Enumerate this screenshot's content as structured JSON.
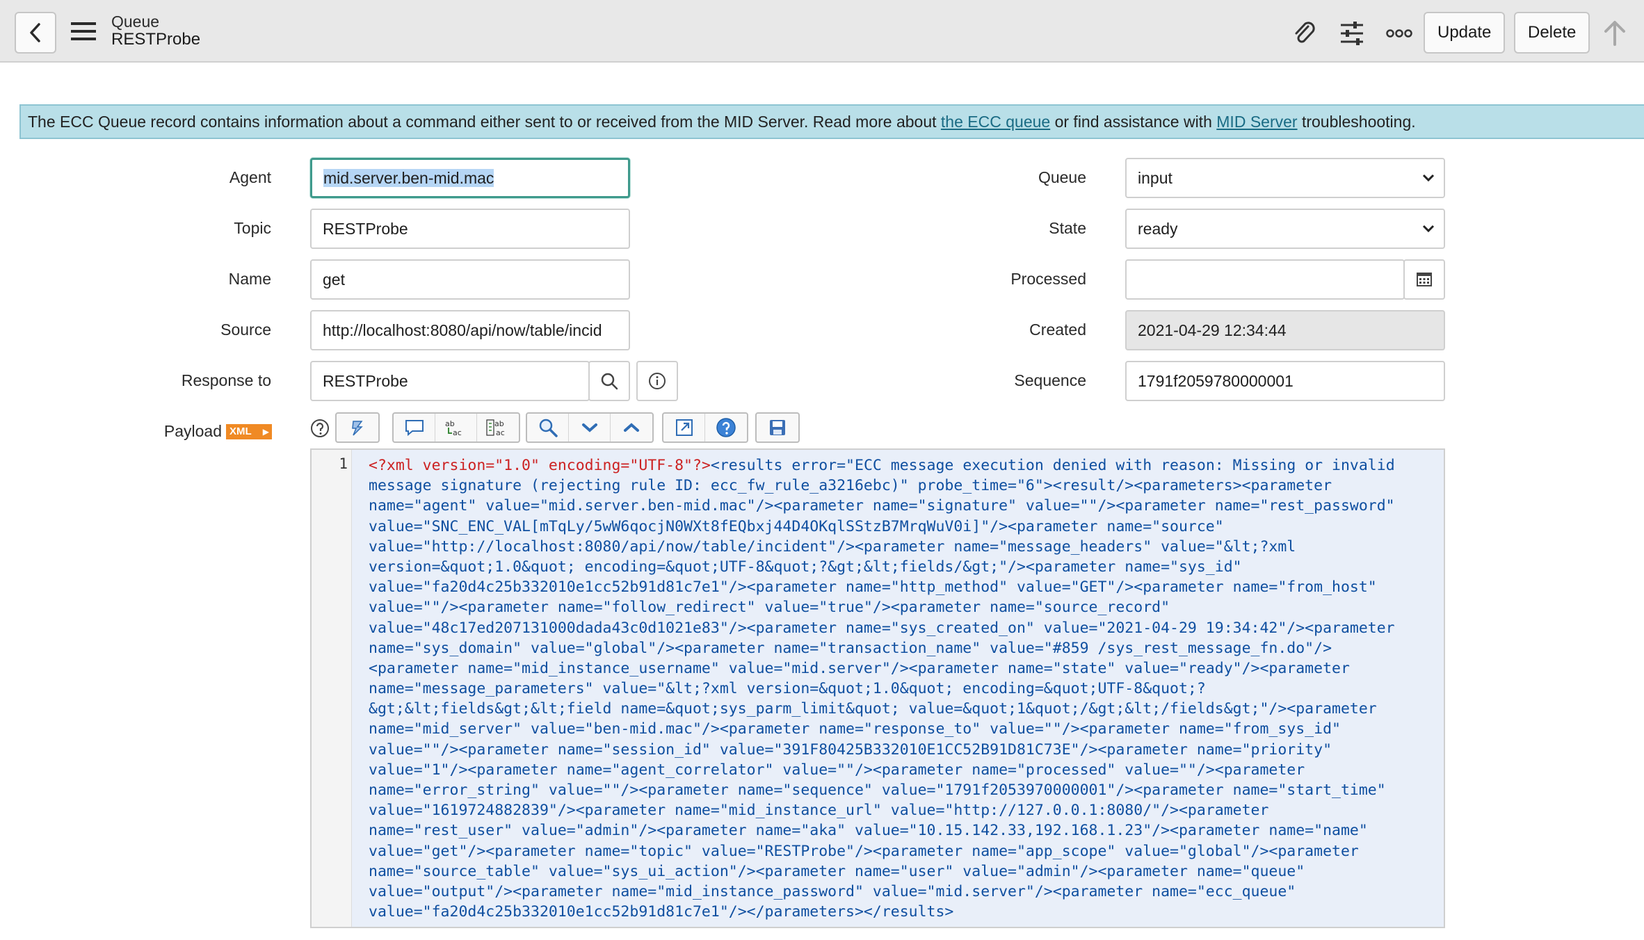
{
  "header": {
    "title": "Queue",
    "subtitle": "RESTProbe",
    "update_label": "Update",
    "delete_label": "Delete"
  },
  "banner": {
    "text_before": "The ECC Queue record contains information about a command either sent to or received from the MID Server. Read more about ",
    "link1": "the ECC queue",
    "text_middle": " or find assistance with ",
    "link2": "MID Server",
    "text_after": " troubleshooting."
  },
  "form": {
    "agent": {
      "label": "Agent",
      "value": "mid.server.ben-mid.mac"
    },
    "topic": {
      "label": "Topic",
      "value": "RESTProbe"
    },
    "name": {
      "label": "Name",
      "value": "get"
    },
    "source": {
      "label": "Source",
      "value": "http://localhost:8080/api/now/table/incid"
    },
    "response_to": {
      "label": "Response to",
      "value": "RESTProbe"
    },
    "payload": {
      "label": "Payload",
      "badge": "XML"
    },
    "queue": {
      "label": "Queue",
      "value": "input"
    },
    "state": {
      "label": "State",
      "value": "ready"
    },
    "processed": {
      "label": "Processed",
      "value": ""
    },
    "created": {
      "label": "Created",
      "value": "2021-04-29 12:34:44"
    },
    "sequence": {
      "label": "Sequence",
      "value": "1791f2059780000001"
    }
  },
  "editor": {
    "line_number": "1",
    "lines": [
      {
        "red": "<?xml version=\"1.0\" encoding=\"UTF-8\"?>",
        "text": "<results error=\"ECC message execution denied with reason: Missing or invalid"
      },
      {
        "text": "message signature (rejecting rule ID: ecc_fw_rule_a3216ebc)\" probe_time=\"6\"><result/><parameters><parameter"
      },
      {
        "text": "name=\"agent\" value=\"mid.server.ben-mid.mac\"/><parameter name=\"signature\" value=\"\"/><parameter name=\"rest_password\""
      },
      {
        "text": "value=\"SNC_ENC_VAL[mTqLy/5wW6qocjN0WXt8fEQbxj44D4OKqlSStzB7MrqWuV0i]\"/><parameter name=\"source\""
      },
      {
        "text": "value=\"http://localhost:8080/api/now/table/incident\"/><parameter name=\"message_headers\" value=\"&lt;?xml"
      },
      {
        "text": "version=&quot;1.0&quot; encoding=&quot;UTF-8&quot;?&gt;&lt;fields/&gt;\"/><parameter name=\"sys_id\""
      },
      {
        "text": "value=\"fa20d4c25b332010e1cc52b91d81c7e1\"/><parameter name=\"http_method\" value=\"GET\"/><parameter name=\"from_host\""
      },
      {
        "text": "value=\"\"/><parameter name=\"follow_redirect\" value=\"true\"/><parameter name=\"source_record\""
      },
      {
        "text": "value=\"48c17ed207131000dada43c0d1021e83\"/><parameter name=\"sys_created_on\" value=\"2021-04-29 19:34:42\"/><parameter"
      },
      {
        "text": "name=\"sys_domain\" value=\"global\"/><parameter name=\"transaction_name\" value=\"#859 /sys_rest_message_fn.do\"/>"
      },
      {
        "text": "<parameter name=\"mid_instance_username\" value=\"mid.server\"/><parameter name=\"state\" value=\"ready\"/><parameter"
      },
      {
        "text": "name=\"message_parameters\" value=\"&lt;?xml version=&quot;1.0&quot; encoding=&quot;UTF-8&quot;?"
      },
      {
        "text": "&gt;&lt;fields&gt;&lt;field name=&quot;sys_parm_limit&quot; value=&quot;1&quot;/&gt;&lt;/fields&gt;\"/><parameter"
      },
      {
        "text": "name=\"mid_server\" value=\"ben-mid.mac\"/><parameter name=\"response_to\" value=\"\"/><parameter name=\"from_sys_id\""
      },
      {
        "text": "value=\"\"/><parameter name=\"session_id\" value=\"391F80425B332010E1CC52B91D81C73E\"/><parameter name=\"priority\""
      },
      {
        "text": "value=\"1\"/><parameter name=\"agent_correlator\" value=\"\"/><parameter name=\"processed\" value=\"\"/><parameter"
      },
      {
        "text": "name=\"error_string\" value=\"\"/><parameter name=\"sequence\" value=\"1791f2053970000001\"/><parameter name=\"start_time\""
      },
      {
        "text": "value=\"1619724882839\"/><parameter name=\"mid_instance_url\" value=\"http://127.0.0.1:8080/\"/><parameter"
      },
      {
        "text": "name=\"rest_user\" value=\"admin\"/><parameter name=\"aka\" value=\"10.15.142.33,192.168.1.23\"/><parameter name=\"name\""
      },
      {
        "text": "value=\"get\"/><parameter name=\"topic\" value=\"RESTProbe\"/><parameter name=\"app_scope\" value=\"global\"/><parameter"
      },
      {
        "text": "name=\"source_table\" value=\"sys_ui_action\"/><parameter name=\"user\" value=\"admin\"/><parameter name=\"queue\""
      },
      {
        "text": "value=\"output\"/><parameter name=\"mid_instance_password\" value=\"mid.server\"/><parameter name=\"ecc_queue\""
      },
      {
        "text": "value=\"fa20d4c25b332010e1cc52b91d81c7e1\"/></parameters></results>"
      }
    ]
  }
}
